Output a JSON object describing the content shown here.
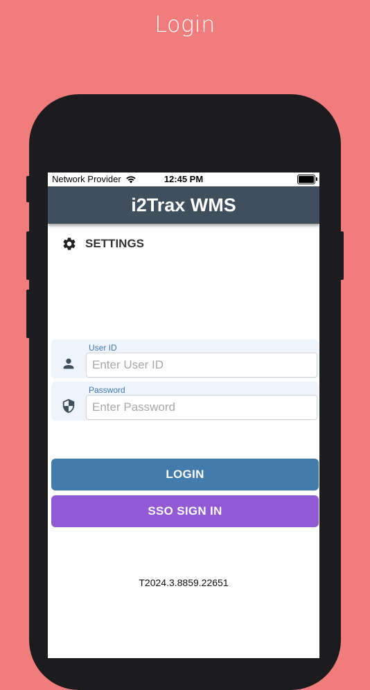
{
  "promo": {
    "caption": "Login"
  },
  "status_bar": {
    "carrier": "Network Provider",
    "time": "12:45 PM"
  },
  "header": {
    "title": "i2Trax WMS"
  },
  "settings": {
    "label": "SETTINGS"
  },
  "form": {
    "user_id": {
      "label": "User ID",
      "placeholder": "Enter User ID",
      "value": ""
    },
    "password": {
      "label": "Password",
      "placeholder": "Enter Password",
      "value": ""
    }
  },
  "buttons": {
    "login_label": "LOGIN",
    "sso_label": "SSO SIGN IN"
  },
  "footer": {
    "version": "T2024.3.8859.22651"
  },
  "icons": {
    "wifi": "wifi-icon",
    "battery": "battery-icon",
    "settings": "gear-icon",
    "user": "person-icon",
    "password": "shield-icon"
  },
  "colors": {
    "background": "#f07c7c",
    "header": "#404f5d",
    "login_button": "#427cad",
    "sso_button": "#9159d3",
    "field_background": "#edf4fc",
    "field_label": "#3f77b0"
  }
}
